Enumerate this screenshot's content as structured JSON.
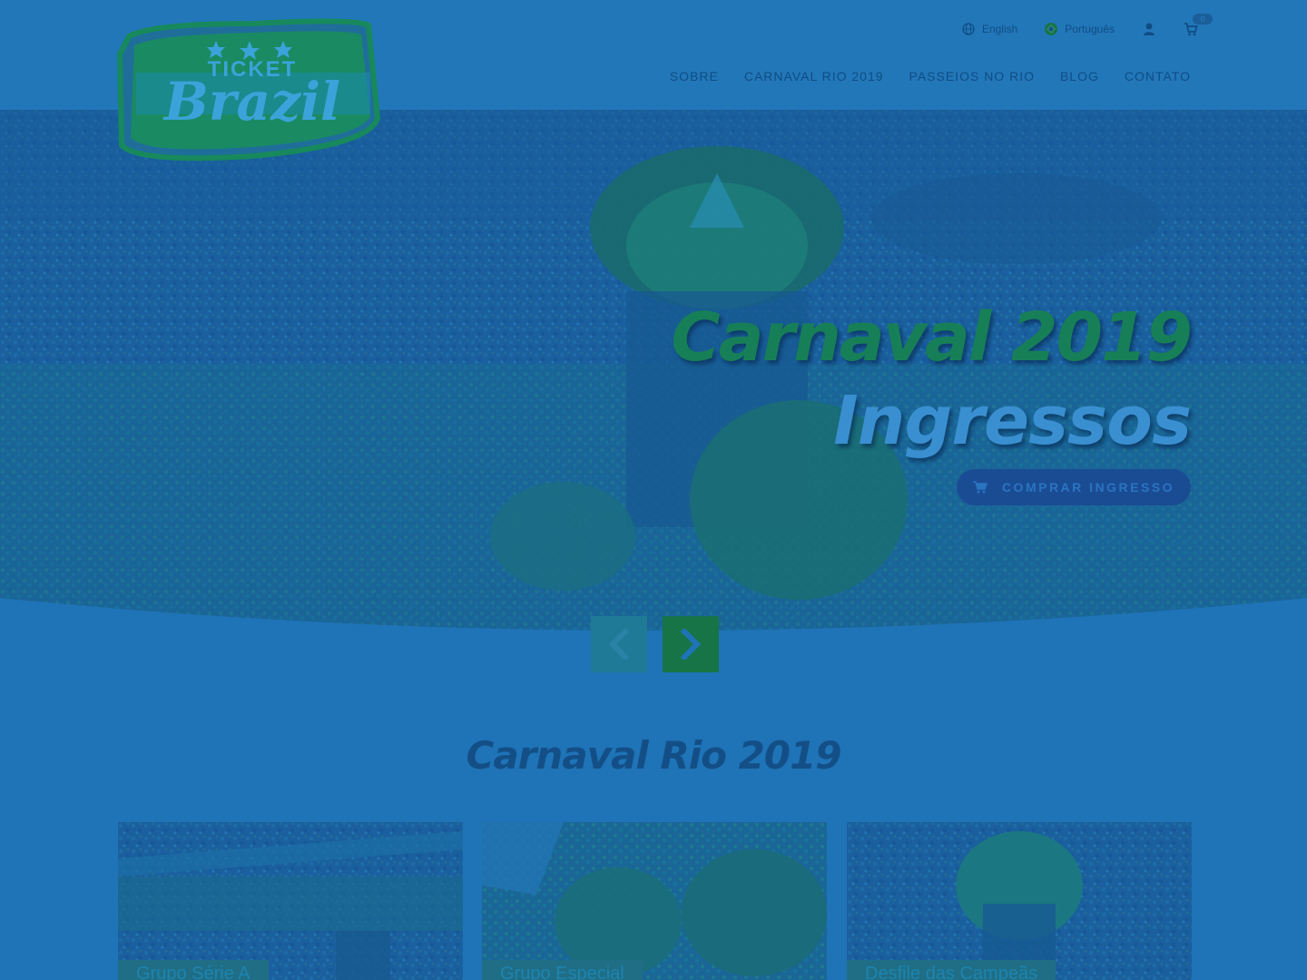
{
  "brand": {
    "logo_top": "TICKET",
    "logo_main": "Brazil"
  },
  "topbar": {
    "lang_english": "English",
    "lang_portugues": "Português",
    "cart_count": "0"
  },
  "nav": {
    "items": [
      {
        "label": "SOBRE"
      },
      {
        "label": "CARNAVAL RIO 2019"
      },
      {
        "label": "PASSEIOS NO RIO"
      },
      {
        "label": "BLOG"
      },
      {
        "label": "CONTATO"
      }
    ]
  },
  "hero": {
    "title_line1": "Carnaval 2019",
    "title_line2": "Ingressos",
    "cta_label": "COMPRAR INGRESSO"
  },
  "section": {
    "title": "Carnaval Rio 2019",
    "cards": [
      {
        "label": "Grupo Série A"
      },
      {
        "label": "Grupo Especial"
      },
      {
        "label": "Desfile das Campeãs"
      }
    ]
  },
  "colors": {
    "overlay": "#1f73b7",
    "green": "#177447",
    "dark_blue": "#0f4d84"
  }
}
